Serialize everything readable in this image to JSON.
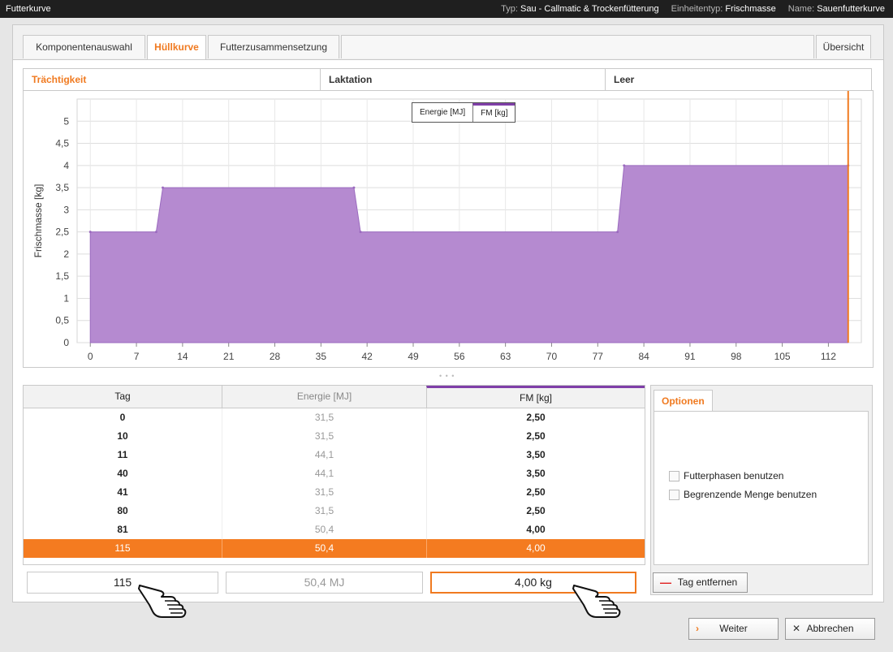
{
  "titlebar": {
    "app_title": "Futterkurve",
    "type_label": "Typ:",
    "type_value": "Sau - Callmatic & Trockenfütterung",
    "unit_label": "Einheitentyp:",
    "unit_value": "Frischmasse",
    "name_label": "Name:",
    "name_value": "Sauenfutterkurve"
  },
  "tabs": [
    {
      "label": "Komponentenauswahl",
      "active": false
    },
    {
      "label": "Hüllkurve",
      "active": true
    },
    {
      "label": "Futterzusammensetzung",
      "active": false
    }
  ],
  "overview_tab": "Übersicht",
  "subtabs": [
    {
      "label": "Trächtigkeit",
      "active": true
    },
    {
      "label": "Laktation",
      "active": false
    },
    {
      "label": "Leer",
      "active": false
    }
  ],
  "legend": {
    "energy": "Energie [MJ]",
    "fm": "FM [kg]",
    "active": "fm"
  },
  "chart_data": {
    "type": "area",
    "ylabel": "Frischmasse [kg]",
    "xlabel": "",
    "xlim": [
      -2,
      117
    ],
    "ylim": [
      0,
      5.5
    ],
    "x_ticks": [
      "0",
      "7",
      "14",
      "21",
      "28",
      "35",
      "42",
      "49",
      "56",
      "63",
      "70",
      "77",
      "84",
      "91",
      "98",
      "105",
      "112"
    ],
    "y_ticks": [
      "0",
      "0,5",
      "1",
      "1,5",
      "2",
      "2,5",
      "3",
      "3,5",
      "4",
      "4,5",
      "5"
    ],
    "series": [
      {
        "x": [
          0,
          10,
          11,
          40,
          41,
          80,
          81,
          115
        ],
        "y": [
          2.5,
          2.5,
          3.5,
          3.5,
          2.5,
          2.5,
          4.0,
          4.0
        ]
      }
    ],
    "marker_x": 115,
    "fill_color": "#b58ad0",
    "line_color": "#9b6bbf",
    "marker_color": "#f07a20",
    "grid": true
  },
  "table": {
    "headers": {
      "day": "Tag",
      "energy": "Energie [MJ]",
      "fm": "FM [kg]"
    },
    "rows": [
      {
        "day": "0",
        "energy": "31,5",
        "fm": "2,50"
      },
      {
        "day": "10",
        "energy": "31,5",
        "fm": "2,50"
      },
      {
        "day": "11",
        "energy": "44,1",
        "fm": "3,50"
      },
      {
        "day": "40",
        "energy": "44,1",
        "fm": "3,50"
      },
      {
        "day": "41",
        "energy": "31,5",
        "fm": "2,50"
      },
      {
        "day": "80",
        "energy": "31,5",
        "fm": "2,50"
      },
      {
        "day": "81",
        "energy": "50,4",
        "fm": "4,00"
      },
      {
        "day": "115",
        "energy": "50,4",
        "fm": "4,00"
      }
    ],
    "selected_row": 7
  },
  "editors": {
    "day": "115",
    "energy": "50,4 MJ",
    "fm": "4,00 kg"
  },
  "options": {
    "tab_label": "Optionen",
    "feed_phases": "Futterphasen benutzen",
    "limit_amount": "Begrenzende Menge benutzen",
    "remove_day": "Tag entfernen"
  },
  "buttons": {
    "next": "Weiter",
    "cancel": "Abbrechen"
  },
  "colors": {
    "accent": "#f07a20",
    "series": "#b58ad0",
    "selection": "#f47b20"
  }
}
